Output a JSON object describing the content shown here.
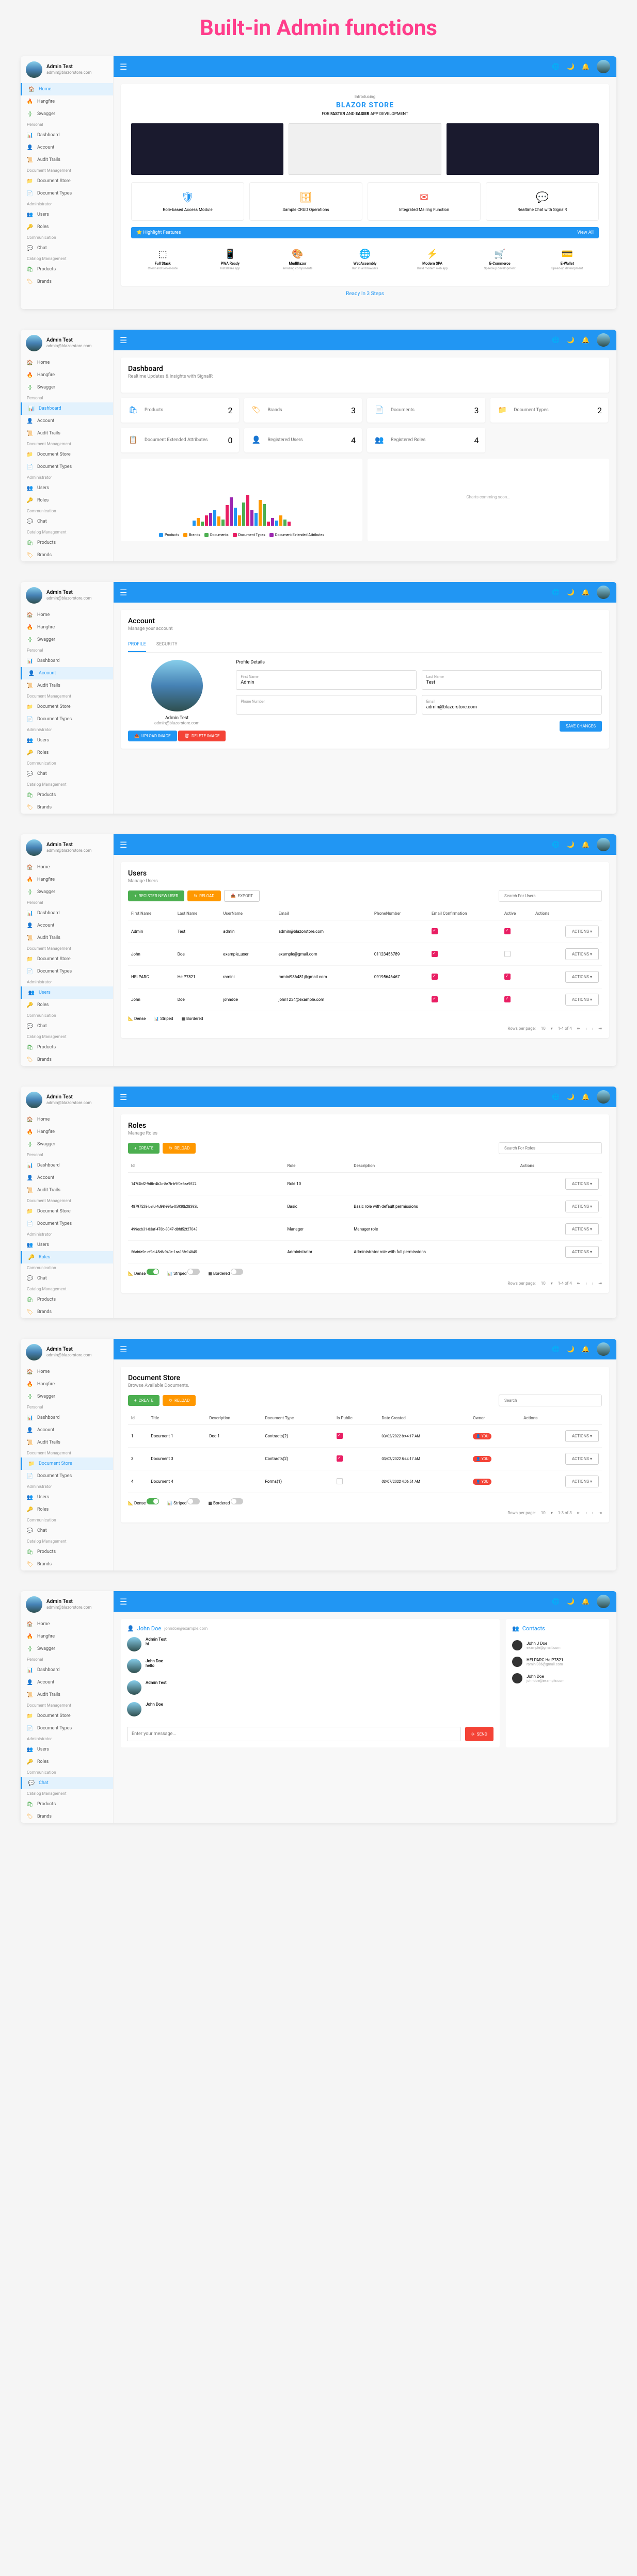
{
  "pageTitle": "Built-in Admin functions",
  "user": {
    "name": "Admin Test",
    "email": "admin@blazorstore.com"
  },
  "nav": {
    "personal": "Personal",
    "docMgmt": "Document Management",
    "admin": "Administrator",
    "comm": "Communication",
    "catalog": "Catalog Management",
    "items": {
      "home": "Home",
      "hangfire": "Hangfire",
      "swagger": "Swagger",
      "dashboard": "Dashboard",
      "account": "Account",
      "audit": "Audit Trails",
      "docStore": "Document Store",
      "docTypes": "Document Types",
      "users": "Users",
      "roles": "Roles",
      "chat": "Chat",
      "products": "Products",
      "brands": "Brands"
    }
  },
  "hero": {
    "intro": "Introducing",
    "title": "BLAZOR STORE",
    "sub1": "FOR",
    "sub2": "FASTER",
    "sub3": "AND",
    "sub4": "EASIER",
    "sub5": "APP DEVELOPMENT",
    "features": [
      "Role-based Access Module",
      "Sample CRUD Operations",
      "Integrated Mailing Function",
      "Realtime Chat with SignalR"
    ],
    "highlightTitle": "Highlight Features",
    "viewAll": "View All",
    "highlights": [
      {
        "t": "Full Stack",
        "s": "Client and Server-side"
      },
      {
        "t": "PWA Ready",
        "s": "Install like app"
      },
      {
        "t": "MudBlazor",
        "s": "amazing components"
      },
      {
        "t": "WebAssembly",
        "s": "Run in all browsers"
      },
      {
        "t": "Modern SPA",
        "s": "Build modern web app"
      },
      {
        "t": "E-Commerce",
        "s": "Speed-up development"
      },
      {
        "t": "E-Wallet",
        "s": "Speed-up development"
      }
    ],
    "footerLink": "Ready In 3 Steps"
  },
  "dashboard": {
    "title": "Dashboard",
    "sub": "Realtime Updates & Insights with SignalR",
    "stats": [
      {
        "label": "Products",
        "val": "2",
        "color": "i-blue",
        "icon": "🛍"
      },
      {
        "label": "Brands",
        "val": "3",
        "color": "i-orange",
        "icon": "🏷"
      },
      {
        "label": "Documents",
        "val": "3",
        "color": "i-teal",
        "icon": "📄"
      },
      {
        "label": "Document Types",
        "val": "2",
        "color": "i-pink",
        "icon": "📁"
      },
      {
        "label": "Document Extended Attributes",
        "val": "0",
        "color": "i-purple",
        "icon": "📋"
      },
      {
        "label": "Registered Users",
        "val": "4",
        "color": "i-red",
        "icon": "👤"
      },
      {
        "label": "Registered Roles",
        "val": "4",
        "color": "i-orange",
        "icon": "👥"
      }
    ],
    "chartLoading": "Charts comming soon...",
    "legendItems": [
      "Products",
      "Brands",
      "Documents",
      "Document Types",
      "Document Extended Attributes"
    ]
  },
  "account": {
    "title": "Account",
    "sub": "Manage your account",
    "tabs": [
      "PROFILE",
      "SECURITY"
    ],
    "name": "Admin Test",
    "email": "admin@blazorstore.com",
    "upload": "UPLOAD IMAGE",
    "delete": "DELETE IMAGE",
    "detailsTitle": "Profile Details",
    "fields": {
      "fn": "First Name",
      "fnv": "Admin",
      "ln": "Last Name",
      "lnv": "Test",
      "phone": "Phone Number",
      "email": "Email",
      "emailv": "admin@blazorstore.com"
    },
    "save": "SAVE CHANGES"
  },
  "users": {
    "title": "Users",
    "sub": "Manage Users",
    "register": "REGISTER NEW USER",
    "reload": "RELOAD",
    "export": "EXPORT",
    "searchPlaceholder": "Search For Users",
    "cols": [
      "First Name",
      "Last Name",
      "UserName",
      "Email",
      "PhoneNumber",
      "Email Confirmation",
      "Active",
      "Actions"
    ],
    "rows": [
      {
        "fn": "Admin",
        "ln": "Test",
        "un": "admin",
        "em": "admin@blazorstore.com",
        "ph": "",
        "ec": true,
        "ac": true
      },
      {
        "fn": "John",
        "ln": "Doe",
        "un": "example_user",
        "em": "example@gmail.com",
        "ph": "01123456789",
        "ec": true,
        "ac": false
      },
      {
        "fn": "HELPARC",
        "ln": "HelP7821",
        "un": "ramini",
        "em": "ramini986481@gmail.com",
        "ph": "09195646467",
        "ec": true,
        "ac": true
      },
      {
        "fn": "John",
        "ln": "Doe",
        "un": "johndoe",
        "em": "john1234@example.com",
        "ph": "",
        "ec": true,
        "ac": true
      }
    ],
    "actionsBtn": "ACTIONS",
    "toggles": {
      "dense": "Dense",
      "striped": "Striped",
      "bordered": "Bordered"
    },
    "pager": {
      "rpp": "Rows per page:",
      "val": "10",
      "range": "1-4 of 4"
    }
  },
  "roles": {
    "title": "Roles",
    "sub": "Manage Roles",
    "create": "CREATE",
    "reload": "RELOAD",
    "searchPlaceholder": "Search For Roles",
    "cols": [
      "Id",
      "Role",
      "Description",
      "Actions"
    ],
    "rows": [
      {
        "id": "147f4bf2-9dfb-4b2c-8e7b-b9f0e6ea9572",
        "role": "Role 10",
        "desc": ""
      },
      {
        "id": "48797529-befd-4d98-99fa-05930b28393b",
        "role": "Basic",
        "desc": "Basic role with default permissions"
      },
      {
        "id": "499ecb31-83af-478b-8047-d8fd52f27043",
        "role": "Manager",
        "desc": "Manager role"
      },
      {
        "id": "56abfa9c-cf9d-45d6-943e-1aa18fe14845",
        "role": "Administrator",
        "desc": "Administrator role with full permissions"
      }
    ],
    "actionsBtn": "ACTIONS",
    "pager": {
      "rpp": "Rows per page:",
      "val": "10",
      "range": "1-4 of 4"
    }
  },
  "docs": {
    "title": "Document Store",
    "sub": "Browse Available Documents.",
    "create": "CREATE",
    "reload": "RELOAD",
    "searchPlaceholder": "Search",
    "cols": [
      "Id",
      "Title",
      "Description",
      "Document Type",
      "Is Public",
      "Date Created",
      "Owner",
      "Actions"
    ],
    "rows": [
      {
        "id": "1",
        "title": "Document 1",
        "desc": "Doc 1",
        "dt": "Contracts(2)",
        "pub": true,
        "date": "03/02/2022 8:44:17 AM",
        "owner": "YOU"
      },
      {
        "id": "3",
        "title": "Document 3",
        "desc": "",
        "dt": "Contracts(2)",
        "pub": true,
        "date": "03/02/2022 8:44:17 AM",
        "owner": "YOU"
      },
      {
        "id": "4",
        "title": "Document 4",
        "desc": "",
        "dt": "Forms(1)",
        "pub": false,
        "date": "03/07/2022 4:06:51 AM",
        "owner": "YOU"
      }
    ],
    "actionsBtn": "ACTIONS",
    "pager": {
      "rpp": "Rows per page:",
      "val": "10",
      "range": "1-3 of 3"
    }
  },
  "chat": {
    "headName": "John Doe",
    "headEmail": "johndoe@example.com",
    "contactsTitle": "Contacts",
    "contacts": [
      {
        "n": "John J Doe",
        "e": "example@gmail.com"
      },
      {
        "n": "HELPARC HelP7821",
        "e": "ramini986@gmail.com"
      },
      {
        "n": "John Doe",
        "e": "johndoe@example.com"
      }
    ],
    "messages": [
      {
        "n": "Admin Test",
        "t": "",
        "b": "hi"
      },
      {
        "n": "John Doe",
        "t": "",
        "b": "hello"
      },
      {
        "n": "Admin Test",
        "t": "",
        "b": ""
      },
      {
        "n": "John Doe",
        "t": "",
        "b": ""
      }
    ],
    "placeholder": "Enter your message...",
    "send": "SEND"
  },
  "chart_data": {
    "type": "bar",
    "series": [
      {
        "name": "Products",
        "color": "#2196f3"
      },
      {
        "name": "Brands",
        "color": "#ff9800"
      },
      {
        "name": "Documents",
        "color": "#4caf50"
      },
      {
        "name": "Document Types",
        "color": "#e91e63"
      },
      {
        "name": "Document Extended Attributes",
        "color": "#9c27b0"
      }
    ],
    "note": "Grouped bar chart showing counts across categories; exact values not labeled"
  }
}
